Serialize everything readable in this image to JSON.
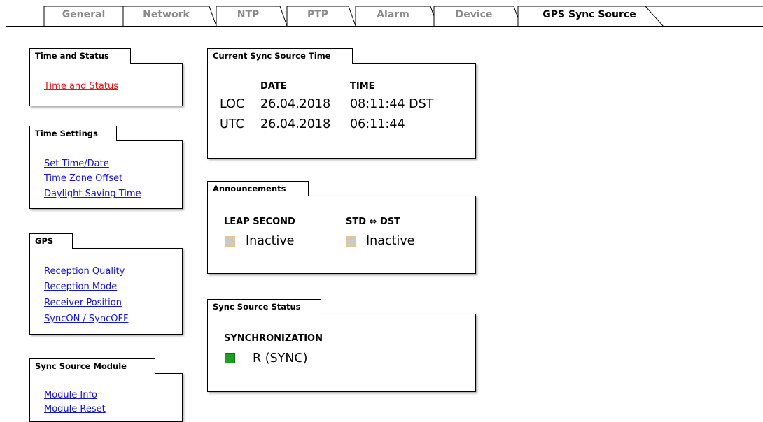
{
  "tabs": [
    {
      "label": "General"
    },
    {
      "label": "Network"
    },
    {
      "label": "NTP"
    },
    {
      "label": "PTP"
    },
    {
      "label": "Alarm"
    },
    {
      "label": "Device"
    },
    {
      "label": "GPS Sync Source"
    }
  ],
  "active_tab": "GPS Sync Source",
  "left_panels": {
    "time_status": {
      "title": "Time and Status",
      "links": [
        "Time and Status"
      ]
    },
    "time_settings": {
      "title": "Time Settings",
      "links": [
        "Set Time/Date",
        "Time Zone Offset",
        "Daylight Saving Time"
      ]
    },
    "gps": {
      "title": "GPS",
      "links": [
        "Reception Quality",
        "Reception Mode",
        "Receiver Position",
        "SyncON / SyncOFF"
      ]
    },
    "sync_module": {
      "title": "Sync Source Module",
      "links": [
        "Module Info",
        "Module Reset"
      ]
    }
  },
  "current_time": {
    "title": "Current Sync Source Time",
    "date_header": "DATE",
    "time_header": "TIME",
    "rows": [
      {
        "label": "LOC",
        "date": "26.04.2018",
        "time": "08:11:44 DST"
      },
      {
        "label": "UTC",
        "date": "26.04.2018",
        "time": "06:11:44"
      }
    ]
  },
  "announcements": {
    "title": "Announcements",
    "leap_second": {
      "label": "LEAP SECOND",
      "value": "Inactive"
    },
    "std_dst": {
      "label": "STD ⇔ DST",
      "value": "Inactive"
    }
  },
  "sync_status": {
    "title": "Sync Source Status",
    "label": "SYNCHRONIZATION",
    "value": "R (SYNC)"
  },
  "colors": {
    "link": "#1515c9",
    "current_link": "#e21515",
    "inactive_indicator": "#c9c9c9",
    "sync_indicator": "#1f9e1f"
  }
}
